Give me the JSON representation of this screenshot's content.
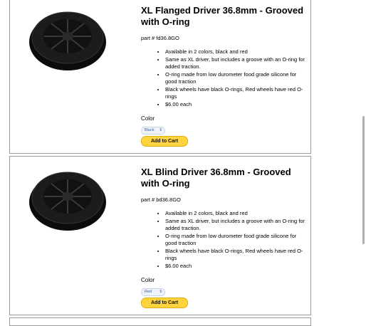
{
  "products": [
    {
      "title": "XL Flanged Driver 36.8mm - Grooved with O-ring",
      "part": "part # fd36.8GO",
      "features": [
        "Available in 2 colors, black and red",
        "Same as XL driver, but includes a groove with an O-ring for added traction.",
        "O-ring made from low durometer food grade silicone for good traction",
        "Black wheels have black O-rings, Red wheels have red O-rings",
        "$6.00 each"
      ],
      "color_label": "Color",
      "color_value": "Black",
      "cart_label": "Add to Cart",
      "image_icon": "wheel-icon"
    },
    {
      "title": "XL Blind Driver 36.8mm - Grooved with O-ring",
      "part": "part # bd36.8GO",
      "features": [
        "Available in 2 colors, black and red",
        "Same as XL driver, but includes a groove with an O-ring for added traction.",
        "O-ring made from low durometer food grade silicone for good traction",
        "Black wheels have black O-rings, Red wheels have red O-rings",
        "$6.00 each"
      ],
      "color_label": "Color",
      "color_value": "Red",
      "cart_label": "Add to Cart",
      "image_icon": "wheel-icon"
    }
  ],
  "colors": {
    "cart_button": "#ffd33d",
    "select_text": "#3b5aa6"
  }
}
